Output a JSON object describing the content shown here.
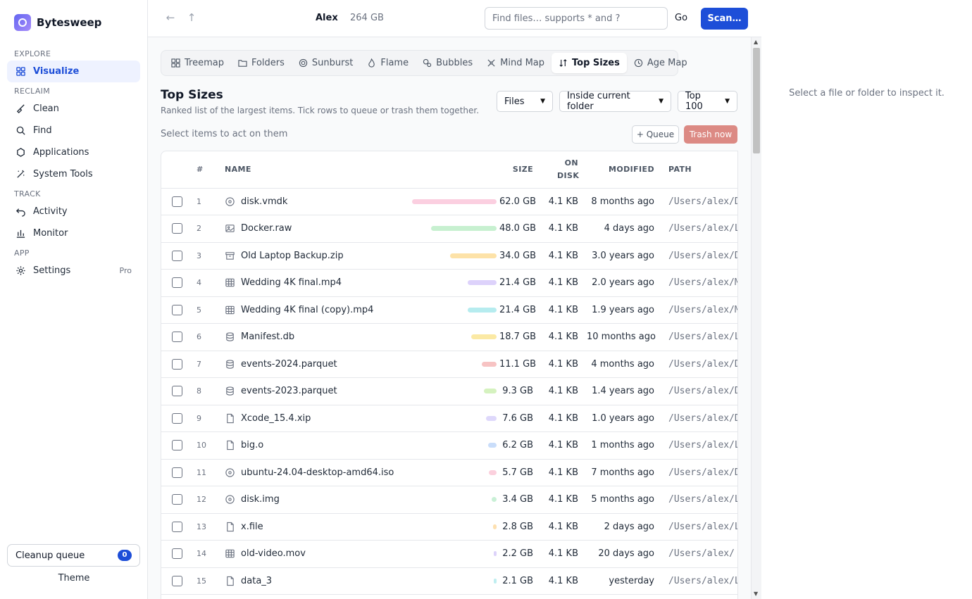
{
  "app": {
    "name": "Bytesweep"
  },
  "sidebar": {
    "sections": [
      {
        "label": "EXPLORE"
      },
      {
        "label": "RECLAIM"
      },
      {
        "label": "TRACK"
      },
      {
        "label": "APP"
      }
    ],
    "items": [
      {
        "label": "Visualize",
        "icon": "grid-icon",
        "active": true
      },
      {
        "label": "Clean",
        "icon": "broom-icon"
      },
      {
        "label": "Find",
        "icon": "search-icon"
      },
      {
        "label": "Applications",
        "icon": "apps-icon"
      },
      {
        "label": "System Tools",
        "icon": "wand-icon"
      },
      {
        "label": "Activity",
        "icon": "undo-icon"
      },
      {
        "label": "Monitor",
        "icon": "bar-chart-icon"
      },
      {
        "label": "Settings",
        "icon": "gear-icon",
        "badge": "Pro"
      }
    ],
    "queue": {
      "label": "Cleanup queue",
      "count": "0"
    },
    "theme": "Theme"
  },
  "topbar": {
    "user": "Alex",
    "disk_size": "264 GB",
    "search_placeholder": "Find files… supports * and ?",
    "go_label": "Go",
    "scan_label": "Scan…"
  },
  "view_tabs": [
    {
      "label": "Treemap",
      "icon": "treemap-icon"
    },
    {
      "label": "Folders",
      "icon": "folder-icon"
    },
    {
      "label": "Sunburst",
      "icon": "sunburst-icon"
    },
    {
      "label": "Flame",
      "icon": "flame-icon"
    },
    {
      "label": "Bubbles",
      "icon": "bubbles-icon"
    },
    {
      "label": "Mind Map",
      "icon": "mindmap-icon"
    },
    {
      "label": "Top Sizes",
      "icon": "sort-icon",
      "active": true
    },
    {
      "label": "Age Map",
      "icon": "clock-icon"
    }
  ],
  "view": {
    "title": "Top Sizes",
    "subtitle": "Ranked list of the largest items. Tick rows to queue or trash them together.",
    "filter_type": "Files",
    "filter_scope": "Inside current folder",
    "filter_limit": "Top 100",
    "hint": "Select items to act on them",
    "queue_label": "+ Queue",
    "trash_label": "Trash now"
  },
  "table": {
    "headers": {
      "num": "#",
      "name": "NAME",
      "size": "SIZE",
      "on_disk": "ON DISK",
      "modified": "MODIFIED",
      "path": "PATH"
    },
    "rows": [
      {
        "n": "1",
        "name": "disk.vmdk",
        "icon": "disc-icon",
        "size": "62.0 GB",
        "size_gb": 62.0,
        "color": "#fbcfe0",
        "on_disk": "4.1 KB",
        "modified": "8 months ago",
        "path": "/Users/alex/D"
      },
      {
        "n": "2",
        "name": "Docker.raw",
        "icon": "image-icon",
        "size": "48.0 GB",
        "size_gb": 48.0,
        "color": "#c7f0d0",
        "on_disk": "4.1 KB",
        "modified": "4 days ago",
        "path": "/Users/alex/L"
      },
      {
        "n": "3",
        "name": "Old Laptop Backup.zip",
        "icon": "archive-icon",
        "size": "34.0 GB",
        "size_gb": 34.0,
        "color": "#fde2a8",
        "on_disk": "4.1 KB",
        "modified": "3.0 years ago",
        "path": "/Users/alex/D"
      },
      {
        "n": "4",
        "name": "Wedding 4K final.mp4",
        "icon": "film-icon",
        "size": "21.4 GB",
        "size_gb": 21.4,
        "color": "#ddd2fb",
        "on_disk": "4.1 KB",
        "modified": "2.0 years ago",
        "path": "/Users/alex/M"
      },
      {
        "n": "5",
        "name": "Wedding 4K final (copy).mp4",
        "icon": "film-icon",
        "size": "21.4 GB",
        "size_gb": 21.4,
        "color": "#b6ecef",
        "on_disk": "4.1 KB",
        "modified": "1.9 years ago",
        "path": "/Users/alex/M"
      },
      {
        "n": "6",
        "name": "Manifest.db",
        "icon": "database-icon",
        "size": "18.7 GB",
        "size_gb": 18.7,
        "color": "#fbe9a4",
        "on_disk": "4.1 KB",
        "modified": "10 months ago",
        "path": "/Users/alex/L"
      },
      {
        "n": "7",
        "name": "events-2024.parquet",
        "icon": "database-icon",
        "size": "11.1 GB",
        "size_gb": 11.1,
        "color": "#f7c3c3",
        "on_disk": "4.1 KB",
        "modified": "4 months ago",
        "path": "/Users/alex/D"
      },
      {
        "n": "8",
        "name": "events-2023.parquet",
        "icon": "database-icon",
        "size": "9.3 GB",
        "size_gb": 9.3,
        "color": "#d5f2bf",
        "on_disk": "4.1 KB",
        "modified": "1.4 years ago",
        "path": "/Users/alex/D"
      },
      {
        "n": "9",
        "name": "Xcode_15.4.xip",
        "icon": "file-icon",
        "size": "7.6 GB",
        "size_gb": 7.6,
        "color": "#ded8fb",
        "on_disk": "4.1 KB",
        "modified": "1.0 years ago",
        "path": "/Users/alex/D"
      },
      {
        "n": "10",
        "name": "big.o",
        "icon": "file-icon",
        "size": "6.2 GB",
        "size_gb": 6.2,
        "color": "#c9ddfa",
        "on_disk": "4.1 KB",
        "modified": "1 months ago",
        "path": "/Users/alex/L"
      },
      {
        "n": "11",
        "name": "ubuntu-24.04-desktop-amd64.iso",
        "icon": "disc-icon",
        "size": "5.7 GB",
        "size_gb": 5.7,
        "color": "#fbd0dd",
        "on_disk": "4.1 KB",
        "modified": "7 months ago",
        "path": "/Users/alex/D"
      },
      {
        "n": "12",
        "name": "disk.img",
        "icon": "disc-icon",
        "size": "3.4 GB",
        "size_gb": 3.4,
        "color": "#c9f0d6",
        "on_disk": "4.1 KB",
        "modified": "5 months ago",
        "path": "/Users/alex/L"
      },
      {
        "n": "13",
        "name": "x.file",
        "icon": "file-icon",
        "size": "2.8 GB",
        "size_gb": 2.8,
        "color": "#fde0b0",
        "on_disk": "4.1 KB",
        "modified": "2 days ago",
        "path": "/Users/alex/L"
      },
      {
        "n": "14",
        "name": "old-video.mov",
        "icon": "film-icon",
        "size": "2.2 GB",
        "size_gb": 2.2,
        "color": "#ddd3fa",
        "on_disk": "4.1 KB",
        "modified": "20 days ago",
        "path": "/Users/alex/ ."
      },
      {
        "n": "15",
        "name": "data_3",
        "icon": "file-icon",
        "size": "2.1 GB",
        "size_gb": 2.1,
        "color": "#bfeef0",
        "on_disk": "4.1 KB",
        "modified": "yesterday",
        "path": "/Users/alex/L"
      }
    ]
  },
  "inspector": {
    "message": "Select a file or folder to inspect it."
  }
}
